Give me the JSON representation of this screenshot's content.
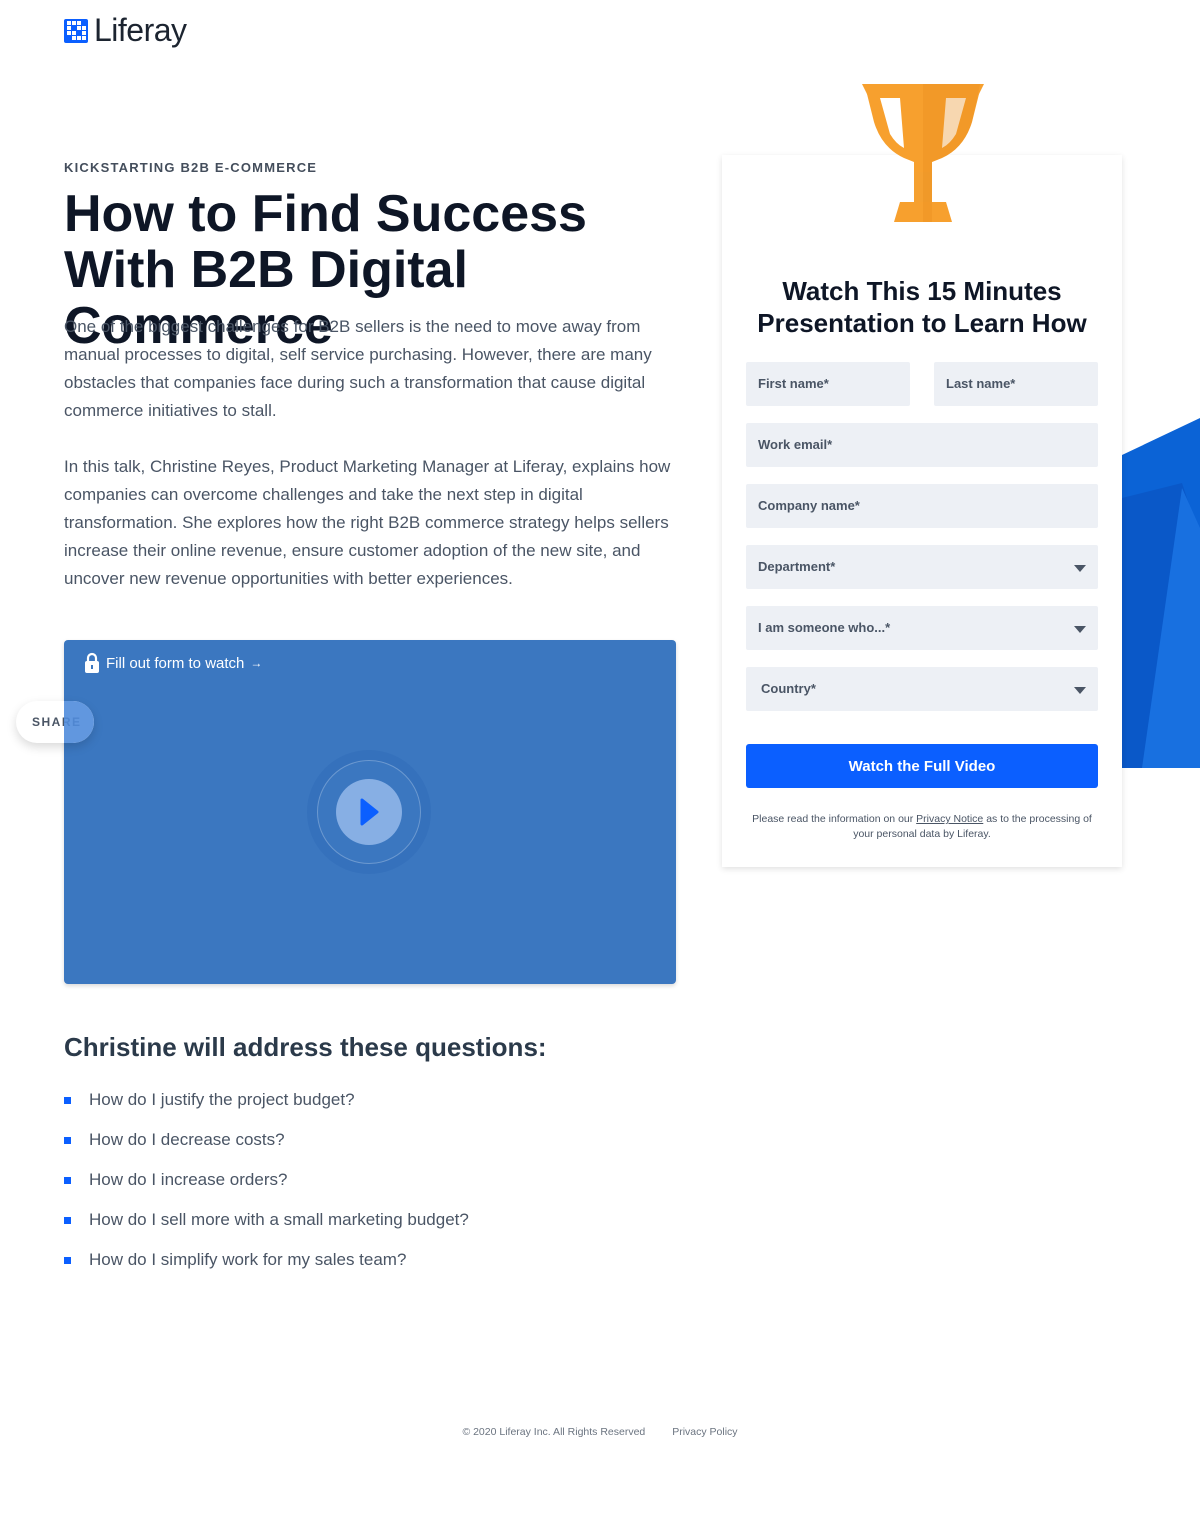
{
  "header": {
    "logo_text": "Liferay"
  },
  "hero": {
    "eyebrow": "KICKSTARTING B2B E-COMMERCE",
    "title": "How to Find Success With B2B Digital Commerce",
    "paragraphs": [
      "One of the biggest challenges for B2B sellers is the need to move away from manual processes to digital, self service purchasing. However, there are many obstacles that companies face during such a transformation that cause digital commerce initiatives to stall.",
      "In this talk, Christine Reyes, Product Marketing Manager at Liferay, explains how companies can overcome challenges and take the next step in digital transformation. She explores how the right B2B commerce strategy helps sellers increase their online revenue, ensure customer adoption of the new site, and uncover new revenue opportunities with better experiences."
    ]
  },
  "video": {
    "locked_label": "Fill out form to watch",
    "arrow": "→"
  },
  "share": {
    "label": "SHARE"
  },
  "questions": {
    "heading": "Christine will address these questions:",
    "items": [
      "How do I justify the project budget?",
      "How do I decrease costs?",
      "How do I increase orders?",
      "How do I sell more with a small marketing budget?",
      "How do I simplify work for my sales team?"
    ]
  },
  "form": {
    "title": "Watch This 15 Minutes Presentation to Learn How",
    "first_name": "First name*",
    "last_name": "Last name*",
    "work_email": "Work email*",
    "company": "Company name*",
    "department": "Department*",
    "role": "I am someone who...*",
    "country": "Country*",
    "submit": "Watch the Full Video",
    "notice_pre": "Please read the information on our ",
    "notice_link": "Privacy Notice",
    "notice_post": " as to the processing of your personal data by Liferay."
  },
  "footer": {
    "copyright": "© 2020 Liferay Inc. All Rights Reserved",
    "privacy": "Privacy Policy"
  },
  "colors": {
    "brand": "#0b5fff",
    "video_bg": "#3b77c0",
    "trophy": "#f7a02e"
  }
}
